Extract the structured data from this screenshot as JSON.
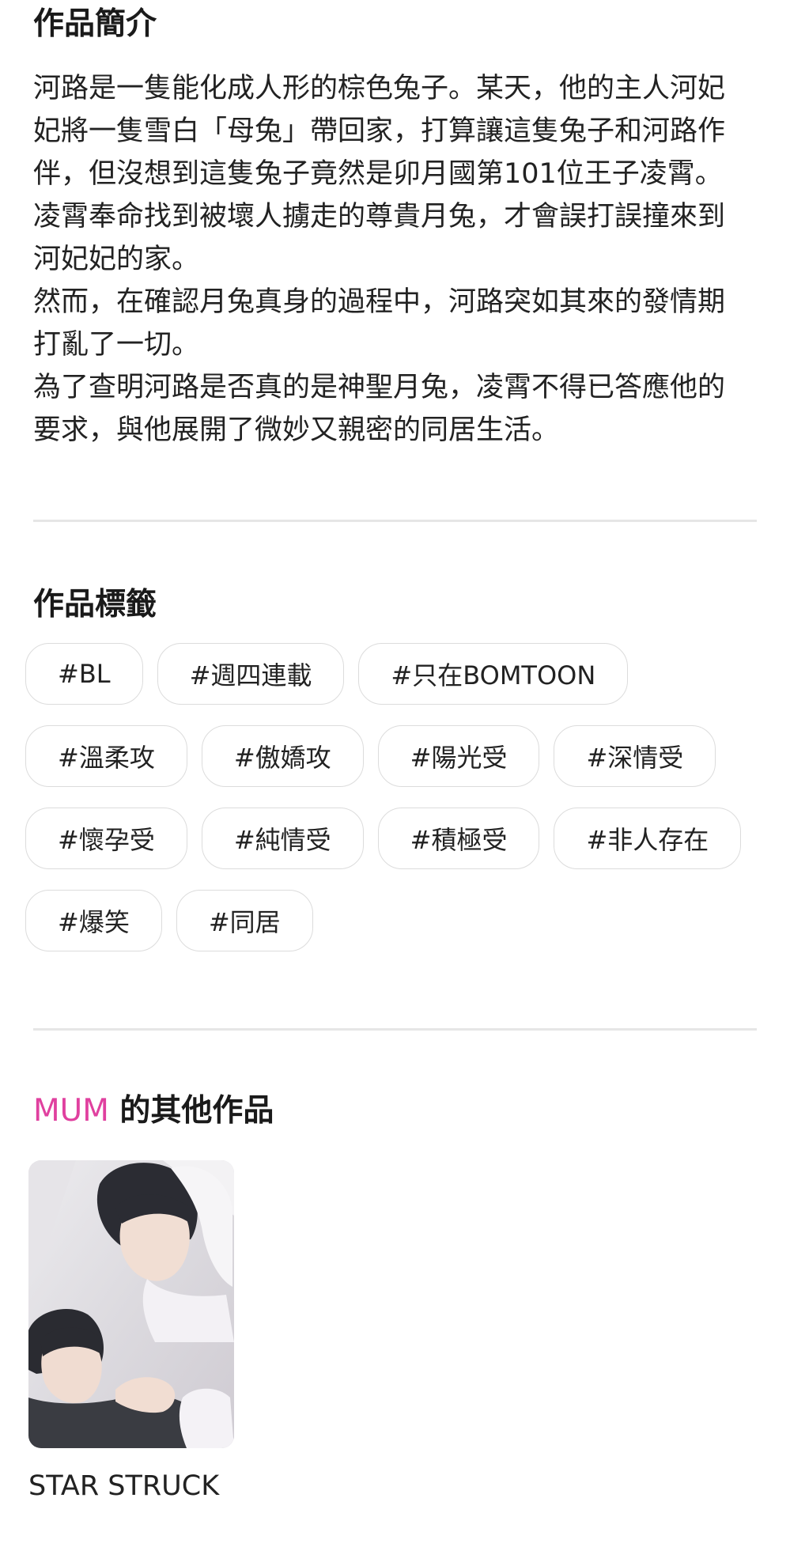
{
  "intro": {
    "title": "作品簡介",
    "lines": [
      "河路是一隻能化成人形的棕色兔子。某天，他的主人河妃",
      "妃將一隻雪白「母兔」帶回家，打算讓這隻兔子和河路作",
      "伴，但沒想到這隻兔子竟然是卯月國第101位王子凌霄。",
      "凌霄奉命找到被壞人擄走的尊貴月兔，才會誤打誤撞來到",
      "河妃妃的家。",
      "然而，在確認月兔真身的過程中，河路突如其來的發情期",
      "打亂了一切。",
      "為了查明河路是否真的是神聖月兔，凌霄不得已答應他的",
      "要求，與他展開了微妙又親密的同居生活。"
    ]
  },
  "tags": {
    "title": "作品標籤",
    "items": [
      "#BL",
      "#週四連載",
      "#只在BOMTOON",
      "#溫柔攻",
      "#傲嬌攻",
      "#陽光受",
      "#深情受",
      "#懷孕受",
      "#純情受",
      "#積極受",
      "#非人存在",
      "#爆笑",
      "#同居"
    ]
  },
  "other_works": {
    "author": "MUM",
    "title_suffix": " 的其他作品",
    "items": [
      {
        "title": "STAR STRUCK"
      }
    ]
  },
  "colors": {
    "author_accent": "#e0409f",
    "divider": "#e6e6e6",
    "tag_border": "#dcdcdc"
  }
}
